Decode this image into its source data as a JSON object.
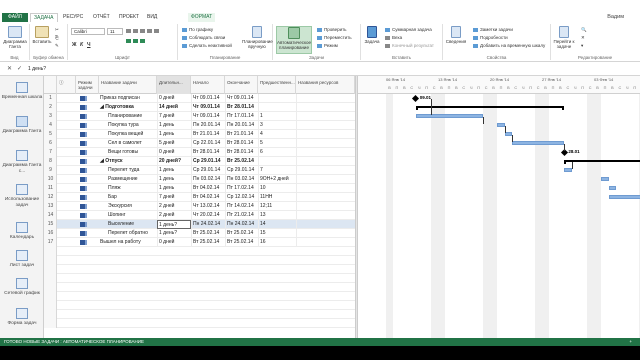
{
  "tabs": [
    "ФАЙЛ",
    "ЗАДАЧА",
    "РЕСУРС",
    "ОТЧЁТ",
    "ПРОЕКТ",
    "ВИД",
    "ФОРМАТ"
  ],
  "user": "Вадим",
  "ribbon": {
    "gantt_view": "Диаграмма Ганта",
    "paste": "Вставить",
    "font_name": "Calibri",
    "font_size": "11",
    "on_schedule": "По графику",
    "respect_links": "Соблюдать связи",
    "make_inactive": "Сделать неактивной",
    "manual": "Планирование вручную",
    "auto": "Автоматическое планирование",
    "inspect": "Проверить",
    "move": "Переместить",
    "mode": "Режим",
    "task": "Задача",
    "summary": "Суммарная задача",
    "milestone": "Веха",
    "deliverable": "Конечный результат",
    "info": "Сведения",
    "notes": "Заметки задачи",
    "details": "Подробности",
    "add_timeline": "Добавить на временную шкалу",
    "scroll": "Перейти к задаче",
    "groups": [
      "Вид",
      "Буфер обмена",
      "Шрифт",
      "Планирование",
      "Задачи",
      "Вставить",
      "Свойства",
      "Редактирование"
    ]
  },
  "formula_value": "1 день?",
  "views": [
    "Временная шкала",
    "Диаграмма Ганта",
    "Диаграмма Ганта с...",
    "Использование задач",
    "Календарь",
    "Лист задач",
    "Сетевой график",
    "Форма задач"
  ],
  "columns": [
    "Режим задачи",
    "Название задачи",
    "Длительн...",
    "Начало",
    "Окончание",
    "Предшественн...",
    "Названия ресурсов"
  ],
  "rows": [
    {
      "n": "1",
      "name": "Приказ подписан",
      "dur": "0 дней",
      "start": "Чт 09.01.14",
      "finish": "Чт 09.01.14",
      "pred": "",
      "indent": 0
    },
    {
      "n": "2",
      "name": "Подготовка",
      "dur": "14 дней",
      "start": "Чт 09.01.14",
      "finish": "Вт 28.01.14",
      "pred": "",
      "indent": 0,
      "summary": true
    },
    {
      "n": "3",
      "name": "Планирование",
      "dur": "7 дней",
      "start": "Чт 09.01.14",
      "finish": "Пт 17.01.14",
      "pred": "1",
      "indent": 2
    },
    {
      "n": "4",
      "name": "Покупка тура",
      "dur": "1 день",
      "start": "Пн 20.01.14",
      "finish": "Пн 20.01.14",
      "pred": "3",
      "indent": 2
    },
    {
      "n": "5",
      "name": "Покупка вещей",
      "dur": "1 день",
      "start": "Вт 21.01.14",
      "finish": "Вт 21.01.14",
      "pred": "4",
      "indent": 2
    },
    {
      "n": "6",
      "name": "Сел в самолет",
      "dur": "5 дней",
      "start": "Ср 22.01.14",
      "finish": "Вт 28.01.14",
      "pred": "5",
      "indent": 2
    },
    {
      "n": "7",
      "name": "Вещи готовы",
      "dur": "0 дней",
      "start": "Вт 28.01.14",
      "finish": "Вт 28.01.14",
      "pred": "6",
      "indent": 2
    },
    {
      "n": "8",
      "name": "Отпуск",
      "dur": "20 дней?",
      "start": "Ср 29.01.14",
      "finish": "Вт 25.02.14",
      "pred": "",
      "indent": 0,
      "summary": true
    },
    {
      "n": "9",
      "name": "Перелет туда",
      "dur": "1 день",
      "start": "Ср 29.01.14",
      "finish": "Ср 29.01.14",
      "pred": "7",
      "indent": 2
    },
    {
      "n": "10",
      "name": "Размещение",
      "dur": "1 день",
      "start": "Пн 03.02.14",
      "finish": "Пн 03.02.14",
      "pred": "9ОН+2 дней",
      "indent": 2
    },
    {
      "n": "11",
      "name": "Пляж",
      "dur": "1 день",
      "start": "Вт 04.02.14",
      "finish": "Пт 17.02.14",
      "pred": "10",
      "indent": 2
    },
    {
      "n": "12",
      "name": "Бар",
      "dur": "7 дней",
      "start": "Вт 04.02.14",
      "finish": "Ср 12.02.14",
      "pred": "11НН",
      "indent": 2
    },
    {
      "n": "13",
      "name": "Экскурсия",
      "dur": "2 дней",
      "start": "Чт 13.02.14",
      "finish": "Пт 14.02.14",
      "pred": "12;11",
      "indent": 2
    },
    {
      "n": "14",
      "name": "Шопинг",
      "dur": "2 дней",
      "start": "Чт 20.02.14",
      "finish": "Пт 21.02.14",
      "pred": "13",
      "indent": 2
    },
    {
      "n": "15",
      "name": "Выселение",
      "dur": "1 день?",
      "start": "Пн 24.02.14",
      "finish": "Пн 24.02.14",
      "pred": "14",
      "indent": 2,
      "selected": true
    },
    {
      "n": "16",
      "name": "Перелет обратно",
      "dur": "1 день?",
      "start": "Вт 25.02.14",
      "finish": "Вт 25.02.14",
      "pred": "15",
      "indent": 2
    },
    {
      "n": "17",
      "name": "Вышел на работу",
      "dur": "0 дней",
      "start": "Вт 25.02.14",
      "finish": "Вт 25.02.14",
      "pred": "16",
      "indent": 0
    }
  ],
  "gantt": {
    "weeks": [
      "06 Янв '14",
      "13 Янв '14",
      "20 Янв '14",
      "27 Янв '14",
      "03 Фев '14"
    ],
    "days": [
      "В",
      "П",
      "В",
      "С",
      "Ч",
      "П",
      "С"
    ],
    "milestones": [
      "09.01",
      "28.01"
    ]
  },
  "status": {
    "text": "ГОТОВО    НОВЫЕ ЗАДАЧИ : АВТОМАТИЧЕСКОЕ ПЛАНИРОВАНИЕ",
    "zoom": "+"
  }
}
